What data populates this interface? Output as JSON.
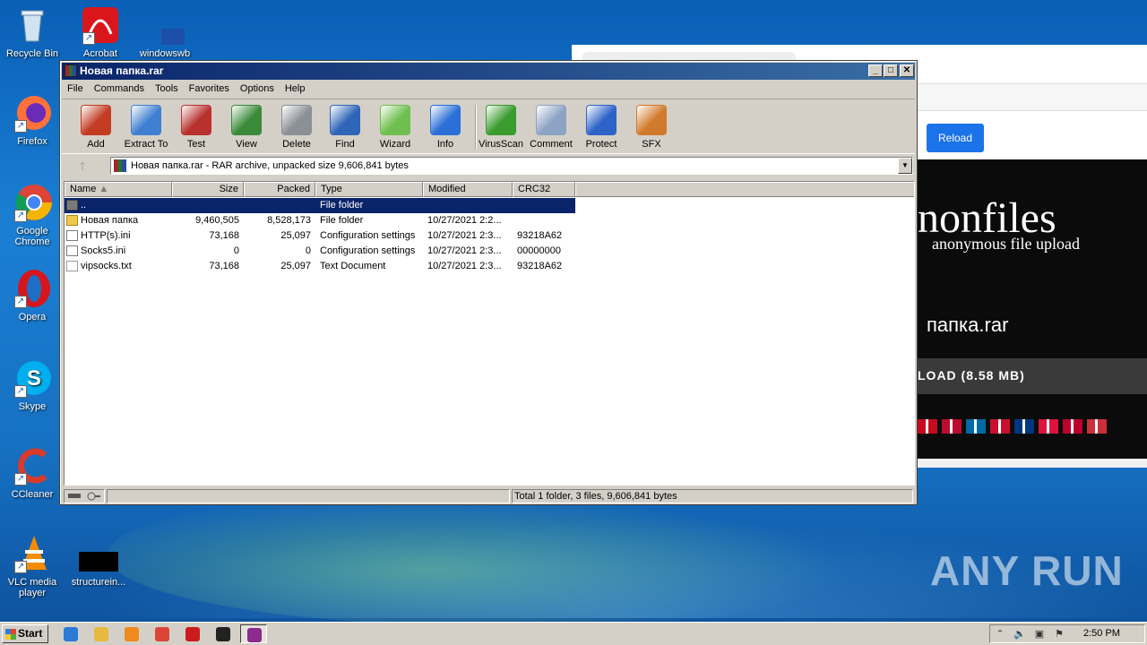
{
  "desktop": {
    "icons": [
      {
        "label": "Recycle Bin",
        "icon": "recycle-bin-icon"
      },
      {
        "label": "Acrobat",
        "icon": "acrobat-icon"
      },
      {
        "label": "windowswb",
        "icon": "file-icon"
      },
      {
        "label": "Firefox",
        "icon": "firefox-icon"
      },
      {
        "label": "Google Chrome",
        "icon": "chrome-icon"
      },
      {
        "label": "Opera",
        "icon": "opera-icon"
      },
      {
        "label": "Skype",
        "icon": "skype-icon"
      },
      {
        "label": "CCleaner",
        "icon": "ccleaner-icon"
      },
      {
        "label": "VLC media player",
        "icon": "vlc-icon"
      },
      {
        "label": "structurein...",
        "icon": "file-icon"
      }
    ]
  },
  "browser": {
    "reload_label": "Reload",
    "logo": "nonfiles",
    "logo_sub": "anonymous file upload",
    "file_name": "папка.rar",
    "download_label": "LOAD (8.58 MB)",
    "flag_colors": [
      "#c60b1e",
      "#ba0c2f",
      "#006aa7",
      "#c8102e",
      "#003580",
      "#dc143c",
      "#bc002d",
      "#cd2e3a"
    ]
  },
  "winrar": {
    "title": "Новая папка.rar",
    "menu": [
      "File",
      "Commands",
      "Tools",
      "Favorites",
      "Options",
      "Help"
    ],
    "toolbar": [
      {
        "label": "Add",
        "icon": "add-archive-icon",
        "color": "#c23b22"
      },
      {
        "label": "Extract To",
        "icon": "extract-folder-icon",
        "color": "#3f7fd1"
      },
      {
        "label": "Test",
        "icon": "test-clipboard-icon",
        "color": "#b8312f"
      },
      {
        "label": "View",
        "icon": "view-book-icon",
        "color": "#3b8a3b"
      },
      {
        "label": "Delete",
        "icon": "delete-trash-icon",
        "color": "#8b8f96"
      },
      {
        "label": "Find",
        "icon": "find-magnifier-icon",
        "color": "#2f65b8"
      },
      {
        "label": "Wizard",
        "icon": "wizard-wand-icon",
        "color": "#6fbf4f"
      },
      {
        "label": "Info",
        "icon": "info-icon",
        "color": "#2a6fd6"
      },
      {
        "label": "VirusScan",
        "icon": "virus-scan-icon",
        "color": "#3a9b2e"
      },
      {
        "label": "Comment",
        "icon": "comment-icon",
        "color": "#8da3c4"
      },
      {
        "label": "Protect",
        "icon": "protect-shield-icon",
        "color": "#2d63c8"
      },
      {
        "label": "SFX",
        "icon": "sfx-box-icon",
        "color": "#d27a2c"
      }
    ],
    "address": "Новая папка.rar - RAR archive, unpacked size 9,606,841 bytes",
    "columns": [
      "Name",
      "Size",
      "Packed",
      "Type",
      "Modified",
      "CRC32"
    ],
    "files": [
      {
        "name": "..",
        "size": "",
        "packed": "",
        "type": "File folder",
        "modified": "",
        "crc": "",
        "kind": "updir"
      },
      {
        "name": "Новая папка",
        "size": "9,460,505",
        "packed": "8,528,173",
        "type": "File folder",
        "modified": "10/27/2021 2:2...",
        "crc": "",
        "kind": "folder"
      },
      {
        "name": "HTTP(s).ini",
        "size": "73,168",
        "packed": "25,097",
        "type": "Configuration settings",
        "modified": "10/27/2021 2:3...",
        "crc": "93218A62",
        "kind": "ini"
      },
      {
        "name": "Socks5.ini",
        "size": "0",
        "packed": "0",
        "type": "Configuration settings",
        "modified": "10/27/2021 2:3...",
        "crc": "00000000",
        "kind": "ini"
      },
      {
        "name": "vipsocks.txt",
        "size": "73,168",
        "packed": "25,097",
        "type": "Text Document",
        "modified": "10/27/2021 2:3...",
        "crc": "93218A62",
        "kind": "txt"
      }
    ],
    "status": "Total 1 folder, 3 files, 9,606,841 bytes"
  },
  "taskbar": {
    "start_label": "Start",
    "clock": "2:50 PM",
    "apps": [
      {
        "icon": "ie-icon",
        "color": "#2a7ad6"
      },
      {
        "icon": "explorer-icon",
        "color": "#e8b940"
      },
      {
        "icon": "media-player-icon",
        "color": "#f08a1c"
      },
      {
        "icon": "chrome-icon",
        "color": "#db4437"
      },
      {
        "icon": "opera-icon",
        "color": "#cc1b1b"
      },
      {
        "icon": "avast-icon",
        "color": "#222222"
      },
      {
        "icon": "winrar-icon",
        "color": "#8b2b8b"
      }
    ]
  },
  "watermark": "ANY RUN"
}
